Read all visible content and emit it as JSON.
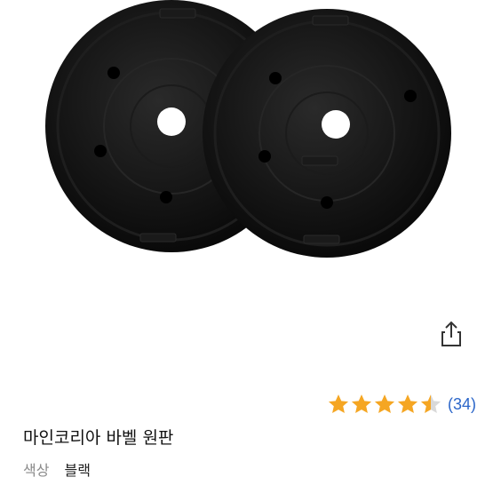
{
  "product": {
    "title": "마인코리아 바벨 원판",
    "attribute": {
      "label": "색상",
      "value": "블랙"
    },
    "image_alt": "barbell weight plates"
  },
  "rating": {
    "stars": 4.5,
    "max": 5,
    "count_text": "(34)",
    "star_color": "#f5a623",
    "empty_color": "#d9d9d9"
  },
  "actions": {
    "share_icon": "share-icon"
  },
  "colors": {
    "link": "#2b66c9",
    "text": "#111111",
    "muted": "#8a8a8a"
  }
}
